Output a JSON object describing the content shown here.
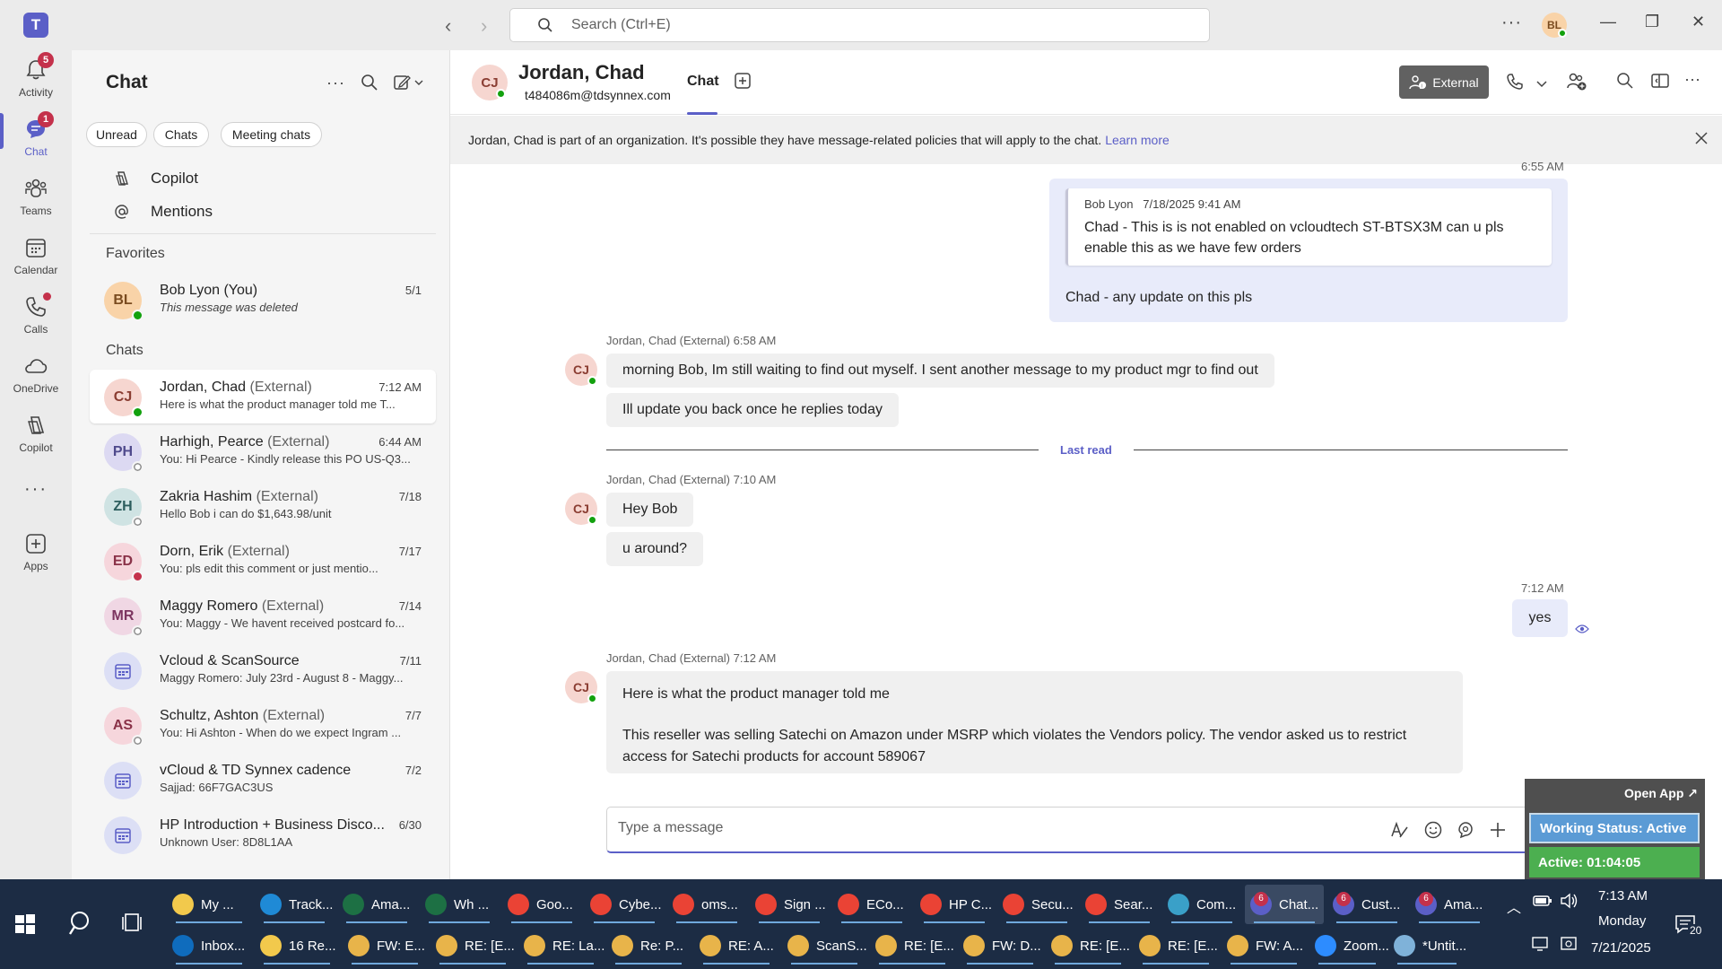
{
  "titlebar": {
    "search_placeholder": "Search (Ctrl+E)",
    "avatar_initials": "BL"
  },
  "rail": {
    "items": [
      {
        "label": "Activity",
        "badge": "5"
      },
      {
        "label": "Chat",
        "badge": "1"
      },
      {
        "label": "Teams"
      },
      {
        "label": "Calendar"
      },
      {
        "label": "Calls"
      },
      {
        "label": "OneDrive"
      },
      {
        "label": "Copilot"
      },
      {
        "label": "Apps"
      }
    ]
  },
  "chatpane": {
    "title": "Chat",
    "filters": [
      "Unread",
      "Chats",
      "Meeting chats"
    ],
    "quick": [
      "Copilot",
      "Mentions"
    ],
    "favorites_label": "Favorites",
    "chats_label": "Chats",
    "favorites": [
      {
        "initials": "BL",
        "name": "Bob Lyon (You)",
        "ext": "",
        "preview": "This message was deleted",
        "time": "5/1",
        "avatar_bg": "#f9d3a8",
        "avatar_fg": "#7a4b1f",
        "status": "available"
      }
    ],
    "chats": [
      {
        "initials": "CJ",
        "name": "Jordan, Chad",
        "ext": "(External)",
        "preview": "Here is what the product manager told me    T...",
        "time": "7:12 AM",
        "avatar_bg": "#f6d6d0",
        "avatar_fg": "#8a3d32",
        "status": "available",
        "active": true
      },
      {
        "initials": "PH",
        "name": "Harhigh, Pearce",
        "ext": "(External)",
        "preview": "You: Hi Pearce  - Kindly release this PO US-Q3...",
        "time": "6:44 AM",
        "avatar_bg": "#dcd9f2",
        "avatar_fg": "#4f4a8c",
        "status": "offline"
      },
      {
        "initials": "ZH",
        "name": "Zakria Hashim",
        "ext": "(External)",
        "preview": "Hello Bob i can do $1,643.98/unit",
        "time": "7/18",
        "avatar_bg": "#cfe3e3",
        "avatar_fg": "#2c5d5d",
        "status": "offline"
      },
      {
        "initials": "ED",
        "name": "Dorn, Erik",
        "ext": "(External)",
        "preview": "You: pls edit this comment or just mentio...",
        "time": "7/17",
        "avatar_bg": "#f6d6dc",
        "avatar_fg": "#8a3248",
        "status": "busy"
      },
      {
        "initials": "MR",
        "name": "Maggy Romero",
        "ext": "(External)",
        "preview": "You: Maggy - We havent received postcard fo...",
        "time": "7/14",
        "avatar_bg": "#f0d7e4",
        "avatar_fg": "#7c3560",
        "status": "offline"
      },
      {
        "initials": "",
        "name": "Vcloud & ScanSource",
        "ext": "",
        "preview": "Maggy Romero: July 23rd - August 8 - Maggy...",
        "time": "7/11",
        "avatar_bg": "#dcdff5",
        "avatar_fg": "#5b5fc7",
        "status": "none"
      },
      {
        "initials": "AS",
        "name": "Schultz, Ashton",
        "ext": "(External)",
        "preview": "You: Hi Ashton  -  When do we expect Ingram ...",
        "time": "7/7",
        "avatar_bg": "#f6d6dc",
        "avatar_fg": "#8a3248",
        "status": "offline"
      },
      {
        "initials": "",
        "name": "vCloud & TD Synnex cadence",
        "ext": "",
        "preview": "Sajjad: 66F7GAC3US",
        "time": "7/2",
        "avatar_bg": "#dcdff5",
        "avatar_fg": "#5b5fc7",
        "status": "none"
      },
      {
        "initials": "",
        "name": "HP Introduction + Business Disco...",
        "ext": "",
        "preview": "Unknown User: 8D8L1AA",
        "time": "6/30",
        "avatar_bg": "#dcdff5",
        "avatar_fg": "#5b5fc7",
        "status": "none"
      }
    ]
  },
  "header": {
    "initials": "CJ",
    "name": "Jordan, Chad",
    "email": "t484086m@tdsynnex.com",
    "tab": "Chat",
    "external_label": "External"
  },
  "banner": {
    "text": "Jordan, Chad is part of an organization. It's possible they have message-related policies that will apply to the chat.",
    "link": "Learn more"
  },
  "messages": {
    "top_time": "6:55 AM",
    "quote_author": "Bob Lyon",
    "quote_time": "7/18/2025 9:41 AM",
    "quote_line1": "Chad - This is is not enabled on vcloudtech ST-BTSX3M can u pls",
    "quote_line2": "enable this as we have few orders",
    "reply_text": "Chad - any update on this pls",
    "group1_header": "Jordan, Chad (External)   6:58 AM",
    "group1_msg1": "morning Bob, Im still waiting to find out myself.  I sent another message to my product mgr to find out",
    "group1_msg2": "Ill update you back once he replies today",
    "last_read": "Last read",
    "group2_header": "Jordan, Chad (External)   7:10 AM",
    "group2_msg1": "Hey Bob",
    "group2_msg2": "u around?",
    "out_time": "7:12 AM",
    "out_msg": "yes",
    "group3_header": "Jordan, Chad (External)   7:12 AM",
    "group3_line1": "Here is what the product manager told me",
    "group3_line2": "This reseller was selling Satechi on Amazon under MSRP which violates the Vendors policy.  The vendor asked us to restrict",
    "group3_line3": "access for Satechi products for account 589067",
    "avatar_initials": "CJ"
  },
  "compose": {
    "placeholder": "Type a message"
  },
  "widget": {
    "open_app": "Open App ↗",
    "working_status": "Working Status: Active",
    "active_time": "Active: 01:04:05"
  },
  "taskbar": {
    "row1": [
      {
        "label": "My ...",
        "color": "#f2c94c"
      },
      {
        "label": "Track...",
        "color": "#1f8ad6"
      },
      {
        "label": "Ama...",
        "color": "#1d7044"
      },
      {
        "label": "Wh ...",
        "color": "#1d7044"
      },
      {
        "label": "Goo...",
        "color": "#ea4335"
      },
      {
        "label": "Cybe...",
        "color": "#ea4335"
      },
      {
        "label": "oms...",
        "color": "#ea4335"
      },
      {
        "label": "Sign ...",
        "color": "#ea4335"
      },
      {
        "label": "ECo...",
        "color": "#ea4335"
      },
      {
        "label": "HP C...",
        "color": "#ea4335"
      },
      {
        "label": "Secu...",
        "color": "#ea4335"
      },
      {
        "label": "Sear...",
        "color": "#ea4335"
      },
      {
        "label": "Com...",
        "color": "#3aa0c8"
      },
      {
        "label": "Chat...",
        "color": "#5b5fc7",
        "badge": "6",
        "active": true
      },
      {
        "label": "Cust...",
        "color": "#5b5fc7",
        "badge": "6"
      },
      {
        "label": "Ama...",
        "color": "#5b5fc7",
        "badge": "6"
      }
    ],
    "row2": [
      {
        "label": "Inbox...",
        "color": "#0f6cbd"
      },
      {
        "label": "16 Re...",
        "color": "#f2c94c"
      },
      {
        "label": "FW: E...",
        "color": "#e8b44a"
      },
      {
        "label": "RE: [E...",
        "color": "#e8b44a"
      },
      {
        "label": "RE: La...",
        "color": "#e8b44a"
      },
      {
        "label": "Re: P...",
        "color": "#e8b44a"
      },
      {
        "label": "RE: A...",
        "color": "#e8b44a"
      },
      {
        "label": "ScanS...",
        "color": "#e8b44a"
      },
      {
        "label": "RE: [E...",
        "color": "#e8b44a"
      },
      {
        "label": "FW: D...",
        "color": "#e8b44a"
      },
      {
        "label": "RE: [E...",
        "color": "#e8b44a"
      },
      {
        "label": "RE: [E...",
        "color": "#e8b44a"
      },
      {
        "label": "FW: A...",
        "color": "#e8b44a"
      },
      {
        "label": "Zoom...",
        "color": "#2d8cff"
      },
      {
        "label": "*Untit...",
        "color": "#7fb2d9"
      }
    ],
    "time": "7:13 AM",
    "day": "Monday",
    "date": "7/21/2025",
    "notif_count": "20"
  }
}
